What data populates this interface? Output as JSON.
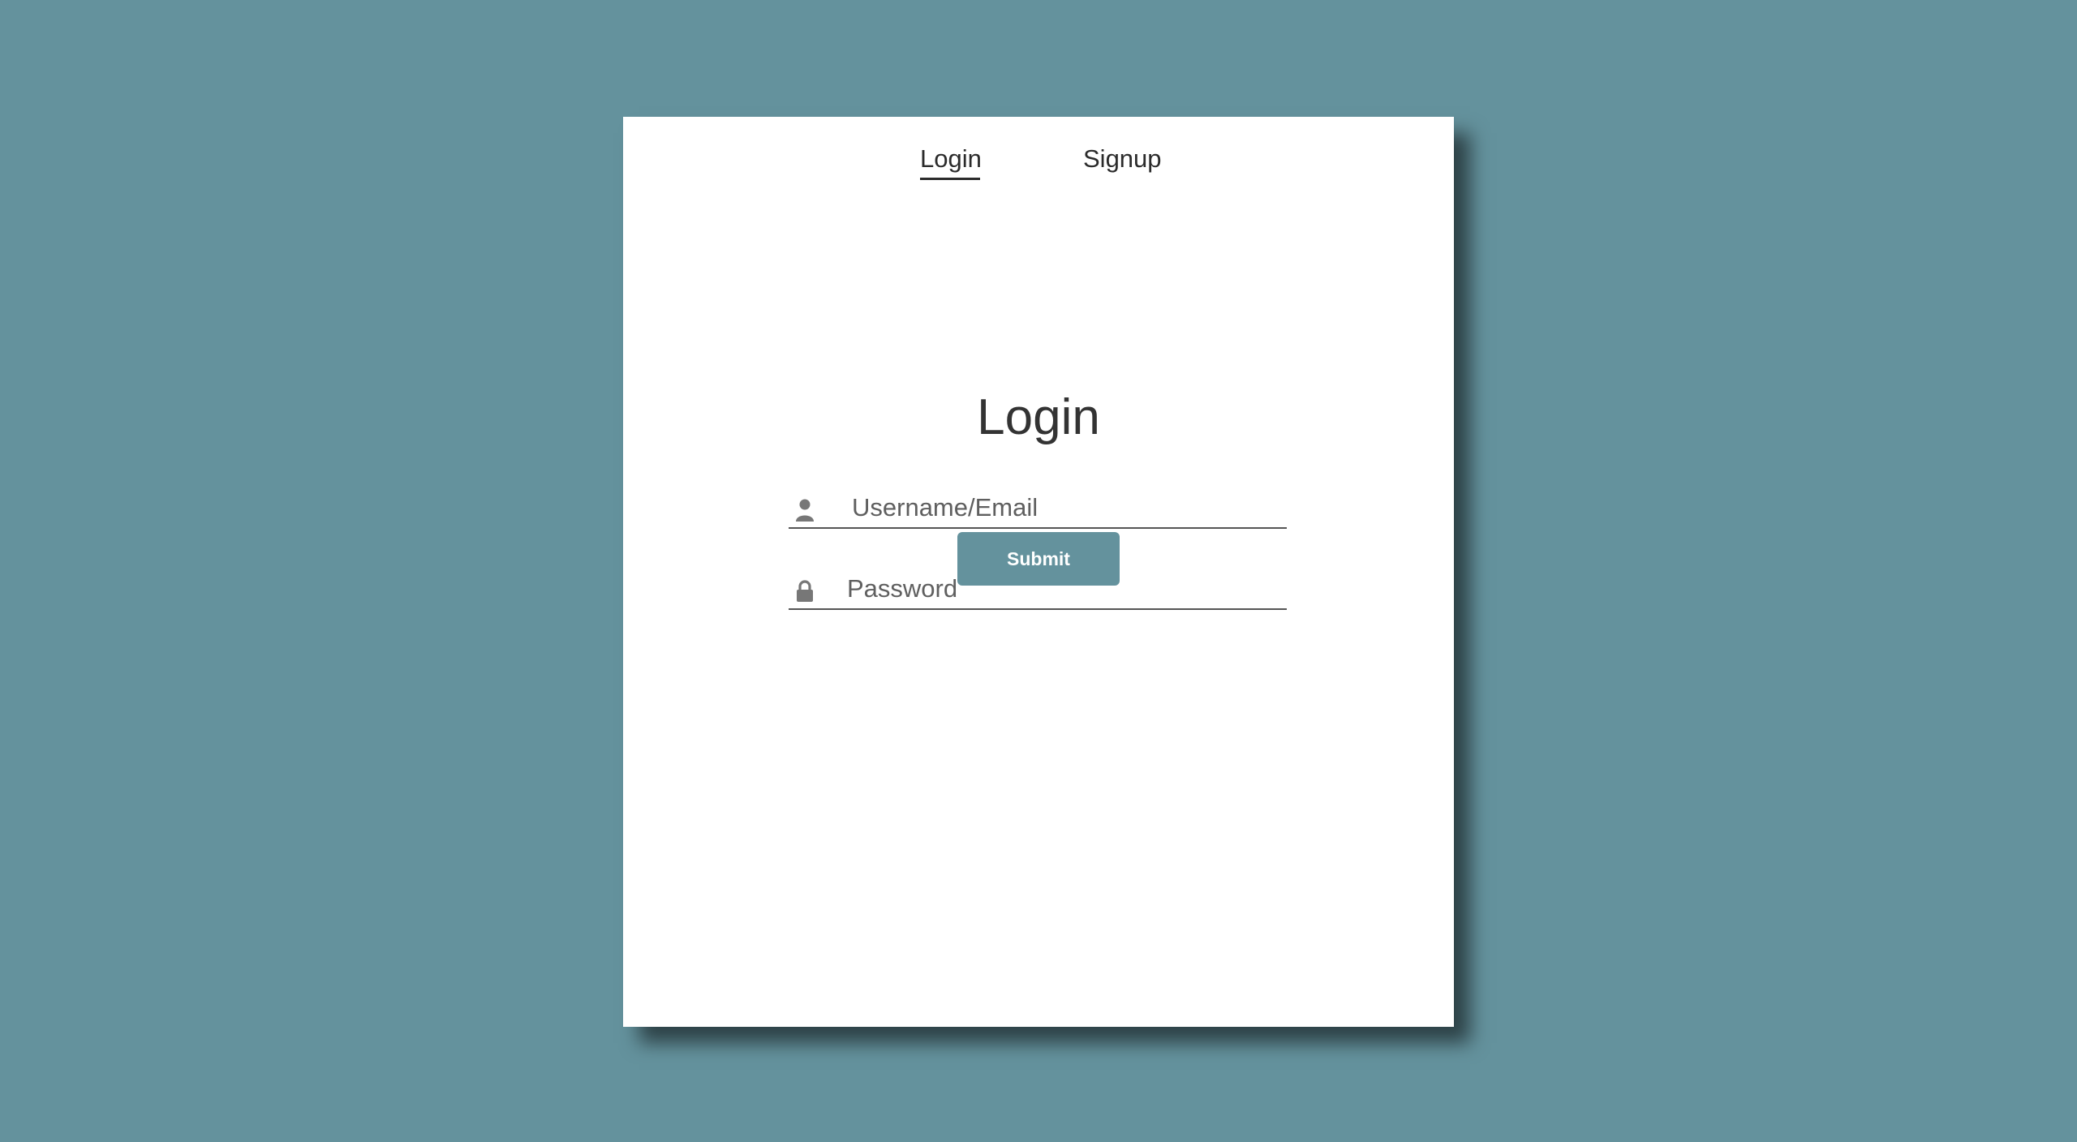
{
  "tabs": {
    "login_label": "Login",
    "signup_label": "Signup",
    "active": "Login"
  },
  "form": {
    "title": "Login",
    "username": {
      "placeholder": "Username/Email",
      "value": "",
      "icon": "user-icon"
    },
    "password": {
      "placeholder": "Password",
      "value": "",
      "icon": "lock-icon"
    },
    "submit_label": "Submit"
  },
  "colors": {
    "background": "#64929d",
    "card": "#ffffff",
    "accent": "#64929d",
    "text": "#333333",
    "icon": "#777777"
  }
}
